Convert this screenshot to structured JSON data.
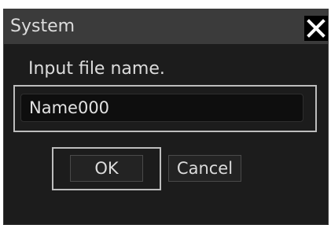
{
  "dialog": {
    "title": "System",
    "close_icon": "close-x-icon",
    "prompt": "Input file name.",
    "file_name": "Name000",
    "ok_label": "OK",
    "cancel_label": "Cancel"
  },
  "colors": {
    "dialog_background": "#1c1c1c",
    "titlebar_background": "#3b3b3b",
    "text": "#dcdcdc",
    "focus_frame": "#bdbdbd",
    "close_button_background": "#000000"
  }
}
